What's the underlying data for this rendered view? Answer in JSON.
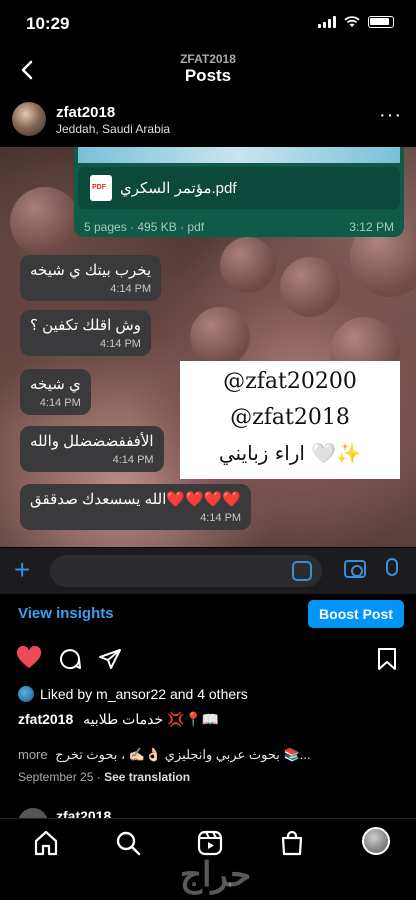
{
  "status": {
    "time": "10:29"
  },
  "header": {
    "account": "ZFAT2018",
    "title": "Posts"
  },
  "post": {
    "username": "zfat2018",
    "location": "Jeddah, Saudi Arabia"
  },
  "media": {
    "document": {
      "name": "مؤتمر السكري.pdf",
      "meta": "5 pages · 495 KB · pdf",
      "time": "3:12 PM"
    },
    "messages": [
      {
        "text": "يخرب بيتك ي شيخه",
        "time": "4:14 PM"
      },
      {
        "text": "وش اقلك تكفين ؟",
        "time": "4:14 PM"
      },
      {
        "text": "ي شيخه",
        "time": "4:14 PM"
      },
      {
        "text": "الأفففضضضلل والله",
        "time": "4:14 PM"
      },
      {
        "text": "الله يسسعدك صدققق❤️❤️❤️❤️",
        "time": "4:14 PM"
      }
    ],
    "card": {
      "line1": "@zfat20200",
      "line2": "@zfat2018",
      "line3": "اراء زبايني 🤍✨"
    }
  },
  "insights": {
    "view_label": "View insights",
    "boost_label": "Boost Post"
  },
  "likes": {
    "text": "Liked by m_ansor22 and 4 others"
  },
  "caption": {
    "username": "zfat2018",
    "text": "خدمات طلابيه 💢📍📖",
    "line2": "بحوث عربي وانجليزي 👌🏻✍🏻 ، بحوث تخرج 📚...",
    "more": "more"
  },
  "meta": {
    "date": "September 25",
    "translate": "See translation"
  },
  "next_post": {
    "username": "zfat2018"
  },
  "watermark": "حراج",
  "colors": {
    "accent_blue": "#0095f6",
    "heart_red": "#ed4956",
    "whatsapp_green": "#0f5b48"
  }
}
